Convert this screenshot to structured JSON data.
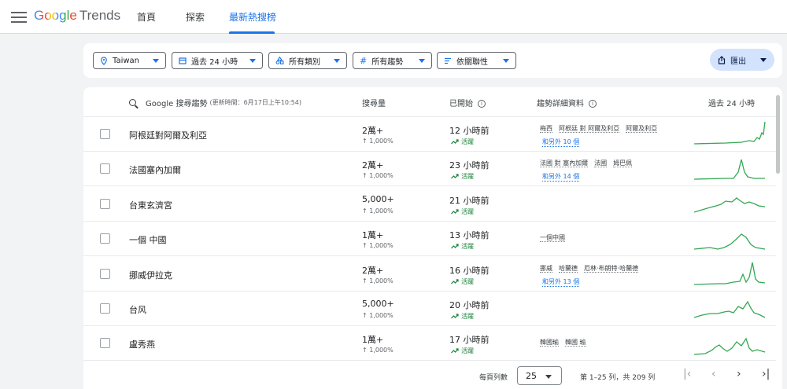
{
  "app": {
    "logo_google": "Google",
    "logo_trends": "Trends"
  },
  "nav": {
    "tabs": [
      {
        "label": "首頁"
      },
      {
        "label": "探索"
      },
      {
        "label": "最新熱搜榜"
      }
    ]
  },
  "filters": {
    "location": "Taiwan",
    "time": "過去 24 小時",
    "category": "所有類別",
    "trend_type": "所有趨勢",
    "sort": "依關聯性",
    "export": "匯出"
  },
  "table": {
    "headers": {
      "search": "Google 搜尋趨勢",
      "updated": "(更新時間：6月17日上午10:54)",
      "volume": "搜尋量",
      "started": "已開始",
      "breakdown": "趨勢詳細資料",
      "past": "過去 24 小時"
    },
    "rows": [
      {
        "term": "阿根廷對阿爾及利亞",
        "volume": "2萬+",
        "change": "↑ 1,000%",
        "started": "12 小時前",
        "status": "活躍",
        "terms": [
          "梅西",
          "阿根廷 對 阿爾及利亞",
          "阿爾及利亞"
        ],
        "more": "和另外 10 個"
      },
      {
        "term": "法國塞內加爾",
        "volume": "2萬+",
        "change": "↑ 1,000%",
        "started": "23 小時前",
        "status": "活躍",
        "terms": [
          "法國 對 塞內加爾",
          "法國",
          "姆巴佩"
        ],
        "more": "和另外 14 個"
      },
      {
        "term": "台東玄濟宮",
        "volume": "5,000+",
        "change": "↑ 1,000%",
        "started": "21 小時前",
        "status": "活躍",
        "terms": [],
        "more": ""
      },
      {
        "term": "一個 中國",
        "volume": "1萬+",
        "change": "↑ 1,000%",
        "started": "13 小時前",
        "status": "活躍",
        "terms": [
          "一個中國"
        ],
        "more": ""
      },
      {
        "term": "挪威伊拉克",
        "volume": "2萬+",
        "change": "↑ 1,000%",
        "started": "16 小時前",
        "status": "活躍",
        "terms": [
          "挪威",
          "哈蘭德",
          "厄林·布朗特·哈蘭德"
        ],
        "more": "和另外 13 個"
      },
      {
        "term": "台风",
        "volume": "5,000+",
        "change": "↑ 1,000%",
        "started": "20 小時前",
        "status": "活躍",
        "terms": [],
        "more": ""
      },
      {
        "term": "盧秀燕",
        "volume": "1萬+",
        "change": "↑ 1,000%",
        "started": "17 小時前",
        "status": "活躍",
        "terms": [
          "韓國瑜",
          "韓國 瑜"
        ],
        "more": ""
      }
    ]
  },
  "pagination": {
    "rows_label": "每頁列數",
    "rows_value": "25",
    "range": "第 1–25 列，共 209 列"
  },
  "colors": {
    "accent": "#1a73e8",
    "active_green": "#188038",
    "spark_green": "#34a853"
  },
  "icons": [
    "menu-icon",
    "location-pin-icon",
    "calendar-icon",
    "category-icon",
    "hashtag-icon",
    "sort-icon",
    "share-icon",
    "search-icon",
    "info-icon",
    "trending-up-icon"
  ]
}
